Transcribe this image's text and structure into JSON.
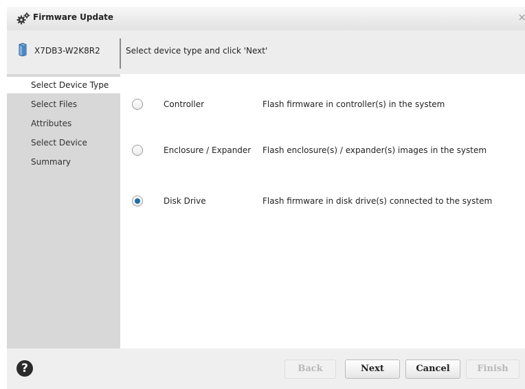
{
  "window": {
    "title": "Firmware Update",
    "close_glyph": "×"
  },
  "device": {
    "name": "X7DB3-W2K8R2",
    "instruction": "Select device type and click 'Next'"
  },
  "sidebar": {
    "items": [
      {
        "label": "Select Device Type",
        "active": true
      },
      {
        "label": "Select Files",
        "active": false
      },
      {
        "label": "Attributes",
        "active": false
      },
      {
        "label": "Select Device",
        "active": false
      },
      {
        "label": "Summary",
        "active": false
      }
    ]
  },
  "options": [
    {
      "name": "Controller",
      "description": "Flash firmware in controller(s) in the system",
      "selected": false
    },
    {
      "name": "Enclosure / Expander",
      "description": "Flash enclosure(s) / expander(s) images in the system",
      "selected": false
    },
    {
      "name": "Disk Drive",
      "description": "Flash firmware in disk drive(s) connected to the system",
      "selected": true
    }
  ],
  "buttons": {
    "back": {
      "label": "Back",
      "enabled": false
    },
    "next": {
      "label": "Next",
      "enabled": true
    },
    "cancel": {
      "label": "Cancel",
      "enabled": true
    },
    "finish": {
      "label": "Finish",
      "enabled": false
    }
  },
  "help_glyph": "?",
  "icons": {
    "title": "gears-icon",
    "device": "server-icon",
    "help": "help-icon",
    "close": "close-icon"
  },
  "colors": {
    "radio_selected": "#1d6fa8",
    "sidebar_bg": "#d8d8d8",
    "header_bg": "#ededed",
    "help_bg": "#2b2b2b"
  }
}
